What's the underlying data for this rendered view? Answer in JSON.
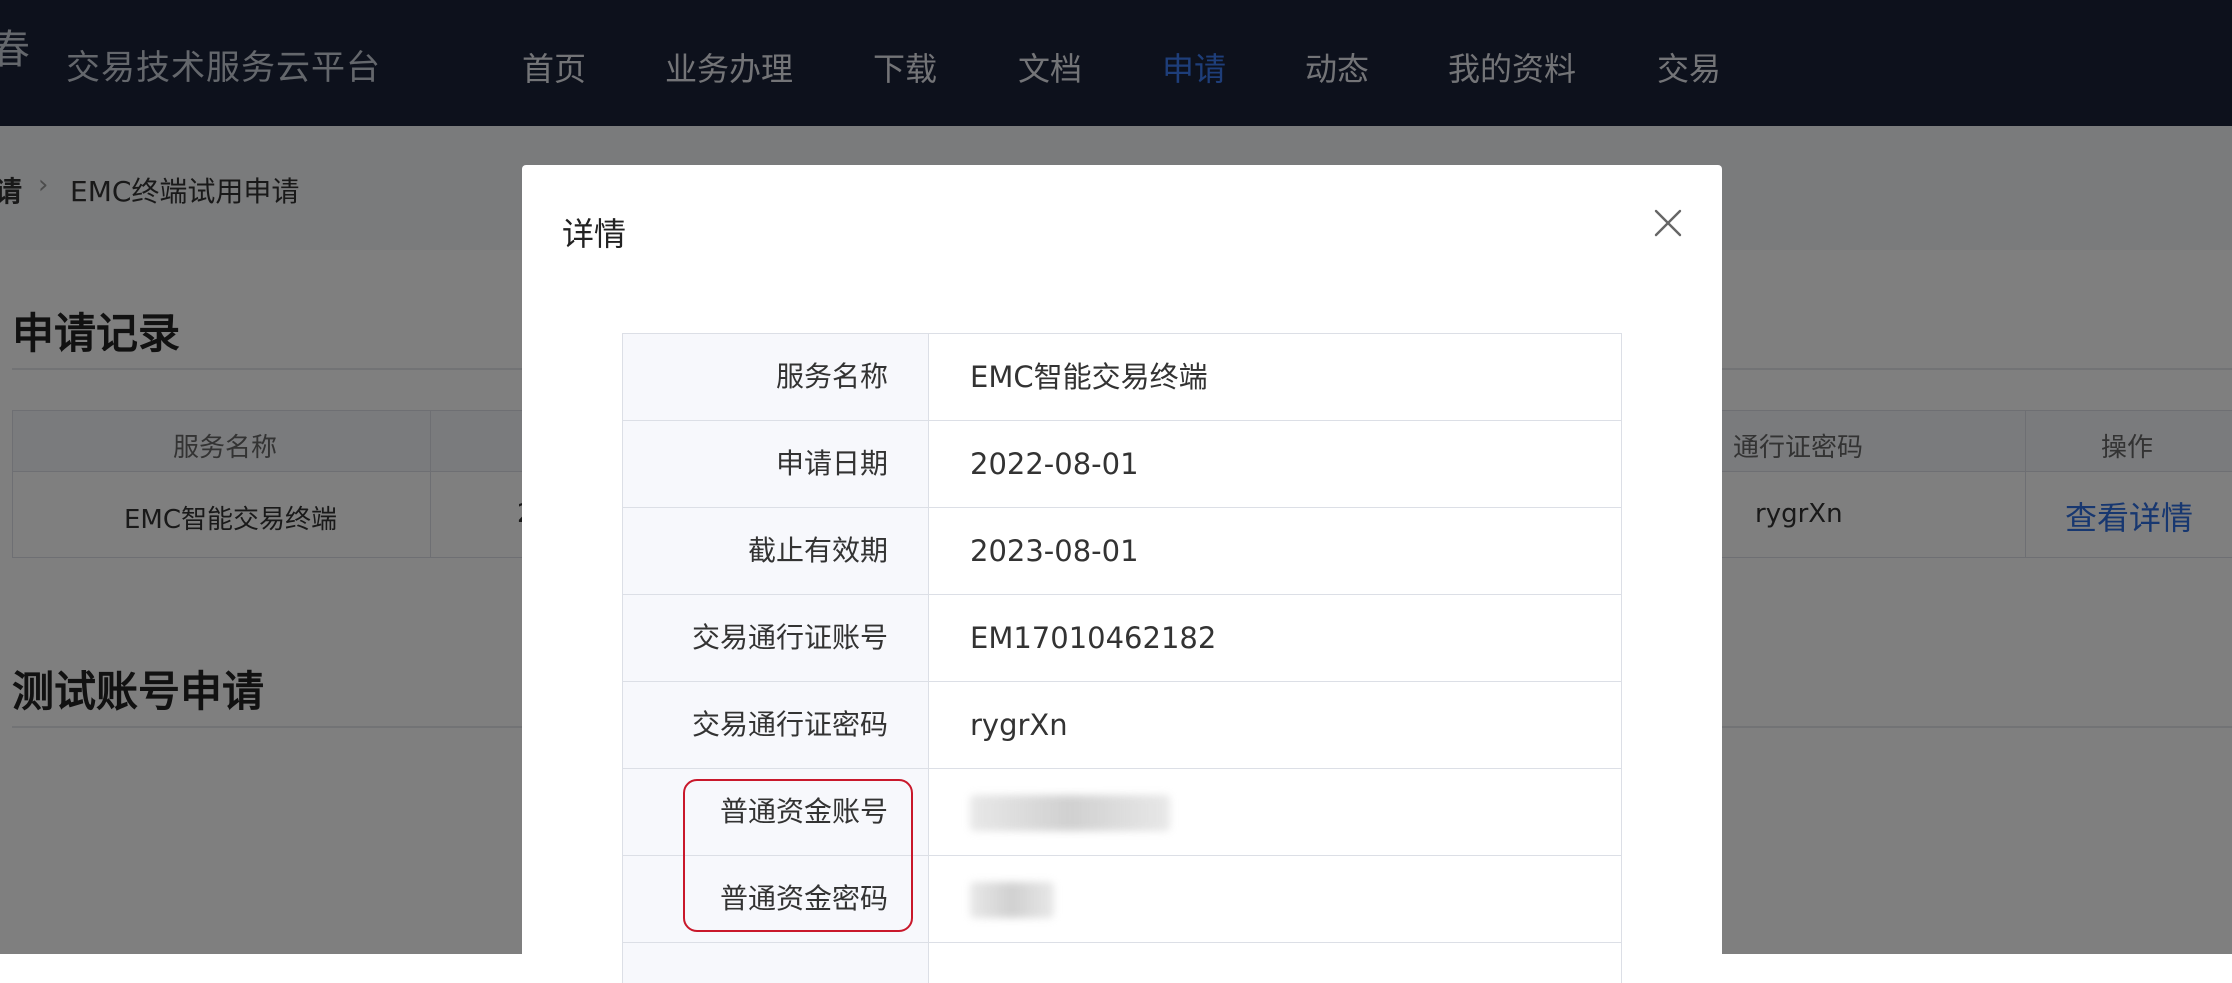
{
  "header": {
    "site_title": "交易技术服务云平台",
    "nav": [
      {
        "label": "首页",
        "active": false
      },
      {
        "label": "业务办理",
        "active": false
      },
      {
        "label": "下载",
        "active": false
      },
      {
        "label": "文档",
        "active": false
      },
      {
        "label": "申请",
        "active": true
      },
      {
        "label": "动态",
        "active": false
      },
      {
        "label": "我的资料",
        "active": false
      },
      {
        "label": "交易",
        "active": false
      }
    ],
    "accent_color": "#3d7df4"
  },
  "breadcrumb": {
    "parent": "请",
    "current": "EMC终端试用申请"
  },
  "records": {
    "title": "申请记录",
    "columns": [
      "服务名称",
      "通行证密码",
      "操作"
    ],
    "row": {
      "service_name": "EMC智能交易终端",
      "partial_value": "2",
      "password": "rygrXn",
      "action_link": "查看详情"
    }
  },
  "test_account": {
    "title": "测试账号申请"
  },
  "modal": {
    "title": "详情",
    "close_icon": "close-icon",
    "rows": [
      {
        "label": "服务名称",
        "value": "EMC智能交易终端"
      },
      {
        "label": "申请日期",
        "value": "2022-08-01"
      },
      {
        "label": "截止有效期",
        "value": "2023-08-01"
      },
      {
        "label": "交易通行证账号",
        "value": "EM17010462182"
      },
      {
        "label": "交易通行证密码",
        "value": "rygrXn"
      },
      {
        "label": "普通资金账号",
        "value": ""
      },
      {
        "label": "普通资金密码",
        "value": ""
      }
    ],
    "highlight_color": "#c9182b"
  }
}
